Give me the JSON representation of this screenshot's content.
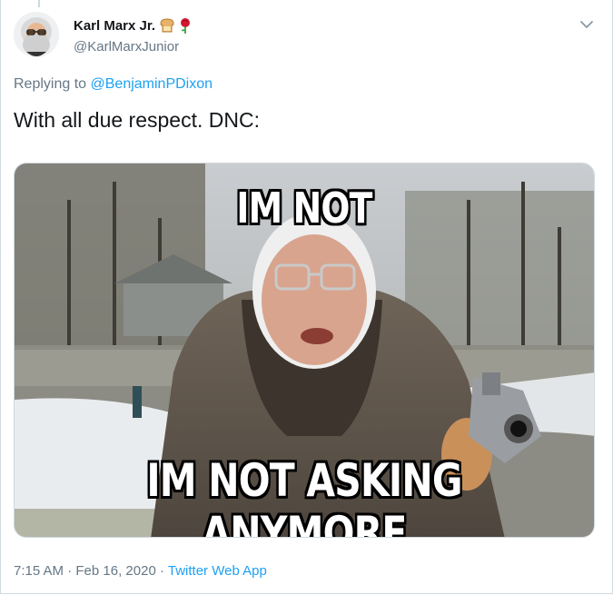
{
  "tweet": {
    "display_name": "Karl Marx Jr.",
    "name_emojis": [
      "bread-emoji",
      "rose-emoji"
    ],
    "handle": "@KarlMarxJunior",
    "reply_prefix": "Replying to",
    "reply_to": "@BenjaminPDixon",
    "text": "With all due respect. DNC:",
    "meme": {
      "top_caption": "IM NOT",
      "bottom_caption": "IM NOT ASKING ANYMORE"
    },
    "time": "7:15 AM",
    "separator": "·",
    "date": "Feb 16, 2020",
    "source": "Twitter Web App"
  },
  "colors": {
    "accent": "#1da1f2",
    "secondary_text": "#657786",
    "primary_text": "#14171a"
  }
}
